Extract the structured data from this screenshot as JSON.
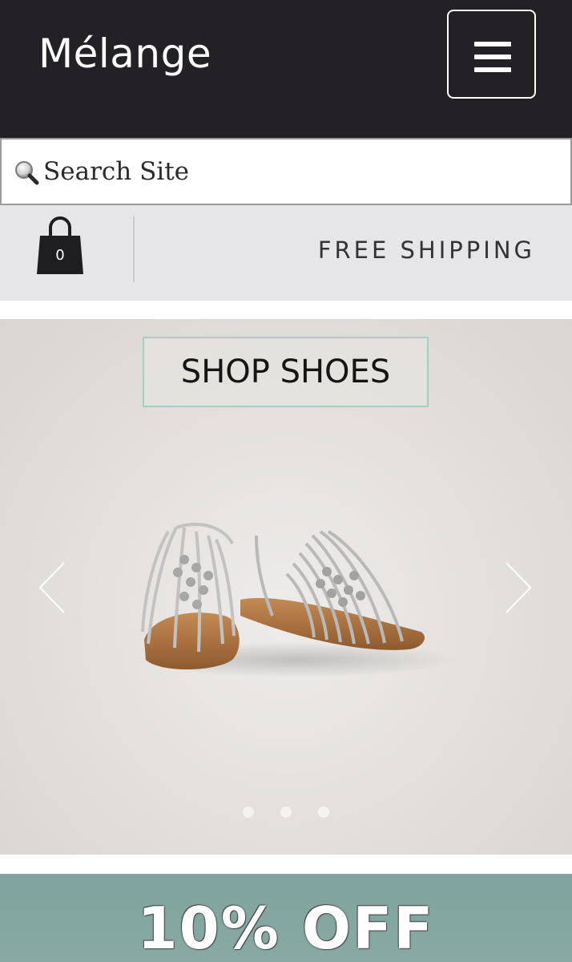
{
  "header": {
    "brand": "Mélange",
    "menu_icon": "hamburger-menu-icon",
    "background": "#232125"
  },
  "search": {
    "placeholder": "Search Site",
    "icon": "magnifier-icon"
  },
  "utility_bar": {
    "cart_count": "0",
    "cart_icon": "shopping-bag-icon",
    "shipping_text": "FREE SHIPPING"
  },
  "hero": {
    "cta_label": "SHOP SHOES",
    "prev_icon": "chevron-left-icon",
    "next_icon": "chevron-right-icon",
    "slides_count": 3,
    "image": "strappy silver sandals"
  },
  "promo": {
    "headline": "10% OFF",
    "background": "#7fa39e"
  }
}
